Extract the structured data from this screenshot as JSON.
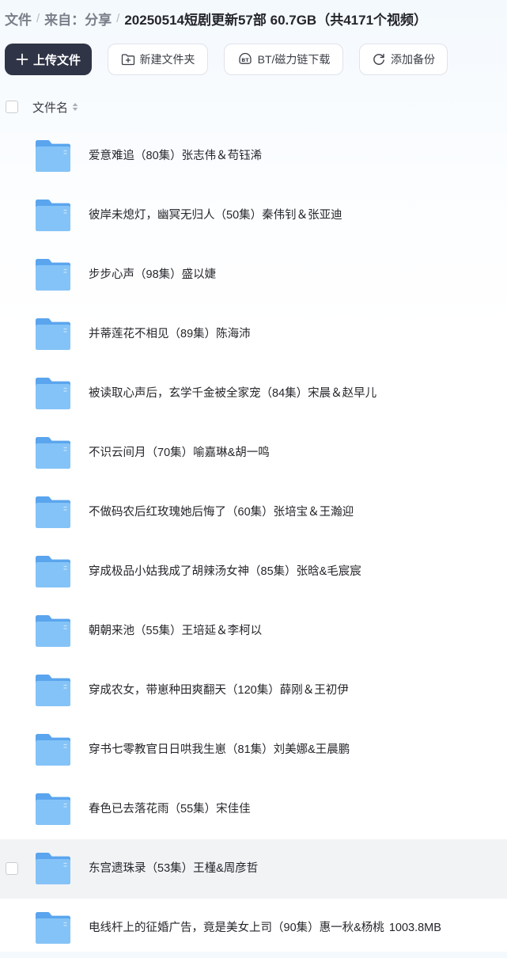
{
  "breadcrumb": {
    "root": "文件",
    "source": "来自：分享",
    "current": "20250514短剧更新57部 60.7GB（共4171个视频）",
    "separator": "/"
  },
  "toolbar": {
    "upload_label": "上传文件",
    "new_folder_label": "新建文件夹",
    "bt_label": "BT/磁力链下载",
    "backup_label": "添加备份"
  },
  "list_header": {
    "name_label": "文件名"
  },
  "files": [
    {
      "name": "爱意难追（80集）张志伟＆苟钰浠",
      "size": ""
    },
    {
      "name": "彼岸未熄灯，幽冥无归人（50集）秦伟钊＆张亚迪",
      "size": ""
    },
    {
      "name": "步步心声（98集）盛以婕",
      "size": ""
    },
    {
      "name": "并蒂莲花不相见（89集）陈海沛",
      "size": ""
    },
    {
      "name": "被读取心声后，玄学千金被全家宠（84集）宋晨＆赵早儿",
      "size": ""
    },
    {
      "name": "不识云间月（70集）喻嘉琳&胡一鸣",
      "size": ""
    },
    {
      "name": "不做码农后红玫瑰她后悔了（60集）张培宝＆王瀚迎",
      "size": ""
    },
    {
      "name": "穿成极品小姑我成了胡辣汤女神（85集）张晗&毛宸宸",
      "size": ""
    },
    {
      "name": "朝朝来池（55集）王培延＆李柯以",
      "size": ""
    },
    {
      "name": "穿成农女，带崽种田爽翻天（120集）薛刚＆王初伊",
      "size": ""
    },
    {
      "name": "穿书七零教官日日哄我生崽（81集）刘美娜&王晨鹏",
      "size": ""
    },
    {
      "name": "春色已去落花雨（55集）宋佳佳",
      "size": ""
    },
    {
      "name": "东宫遗珠录（53集）王槿&周彦哲",
      "size": ""
    },
    {
      "name": "电线杆上的征婚广告，竟是美女上司（90集）惠一秋&杨桃",
      "size": "1003.8MB"
    }
  ],
  "hovered_row_index": 12,
  "colors": {
    "primary_button": "#2f3446",
    "folder_front": "#84c3f7",
    "folder_back": "#5aa5ee",
    "hover_row": "#f2f3f5",
    "muted_text": "#7a7f8a"
  },
  "icons": {
    "upload": "plus-icon",
    "new_folder": "folder-plus-icon",
    "bt": "bt-icon",
    "backup": "refresh-icon",
    "sort": "sort-icon",
    "file": "folder-icon"
  }
}
